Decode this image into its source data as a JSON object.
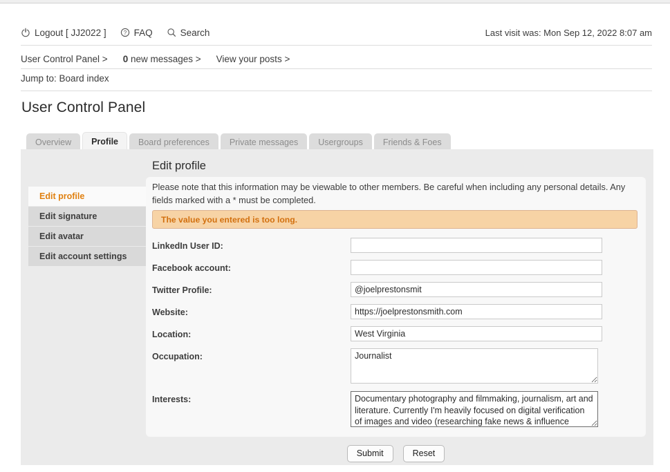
{
  "header": {
    "links": [
      {
        "label": "Logout [ JJ2022 ]",
        "icon": "power-icon"
      },
      {
        "label": "FAQ",
        "icon": "question-circle-icon"
      },
      {
        "label": "Search",
        "icon": "search-icon"
      }
    ],
    "last_visit": "Last visit was: Mon Sep 12, 2022 8:07 am"
  },
  "breadcrumbs": [
    {
      "label": "User Control Panel >",
      "bold_prefix": ""
    },
    {
      "label": " new messages >",
      "bold_prefix": "0"
    },
    {
      "label": "View your posts >",
      "bold_prefix": ""
    }
  ],
  "jump_to": {
    "prefix": "Jump to:",
    "link": "Board index"
  },
  "page_title": "User Control Panel",
  "tabs": [
    {
      "label": "Overview",
      "active": false
    },
    {
      "label": "Profile",
      "active": true
    },
    {
      "label": "Board preferences",
      "active": false
    },
    {
      "label": "Private messages",
      "active": false
    },
    {
      "label": "Usergroups",
      "active": false
    },
    {
      "label": "Friends & Foes",
      "active": false
    }
  ],
  "sidebar": {
    "items": [
      {
        "label": "Edit profile",
        "active": true
      },
      {
        "label": "Edit signature",
        "active": false
      },
      {
        "label": "Edit avatar",
        "active": false
      },
      {
        "label": "Edit account settings",
        "active": false
      }
    ]
  },
  "content": {
    "title": "Edit profile",
    "intro": "Please note that this information may be viewable to other members. Be careful when including any personal details. Any fields marked with a * must be completed.",
    "alert": "The value you entered is too long."
  },
  "form": {
    "linkedin": {
      "label": "LinkedIn User ID:",
      "value": "",
      "placeholder": ""
    },
    "facebook": {
      "label": "Facebook account:",
      "value": "",
      "placeholder": ""
    },
    "twitter": {
      "label": "Twitter Profile:",
      "value": "@joelprestonsmit",
      "placeholder": ""
    },
    "website": {
      "label": "Website:",
      "value": "https://joelprestonsmith.com",
      "placeholder": ""
    },
    "location": {
      "label": "Location:",
      "value": "West Virginia",
      "placeholder": ""
    },
    "occupation": {
      "label": "Occupation:",
      "value": "Journalist",
      "placeholder": ""
    },
    "interests": {
      "label": "Interests:",
      "value": "Documentary photography and filmmaking, journalism, art and literature. Currently I'm heavily focused on digital verification of images and video (researching fake news & influence operations)",
      "placeholder": ""
    }
  },
  "buttons": {
    "submit": "Submit",
    "reset": "Reset"
  },
  "colors": {
    "accent_orange": "#e08010",
    "alert_bg": "#f7d3a5",
    "alert_border": "#ddb391",
    "alert_text": "#d2700f",
    "panel_bg": "#ebebeb",
    "card_bg": "#f8f8f8",
    "sidebar_item_bg": "#d9d9d9",
    "tab_bg": "#dcdcdc"
  }
}
